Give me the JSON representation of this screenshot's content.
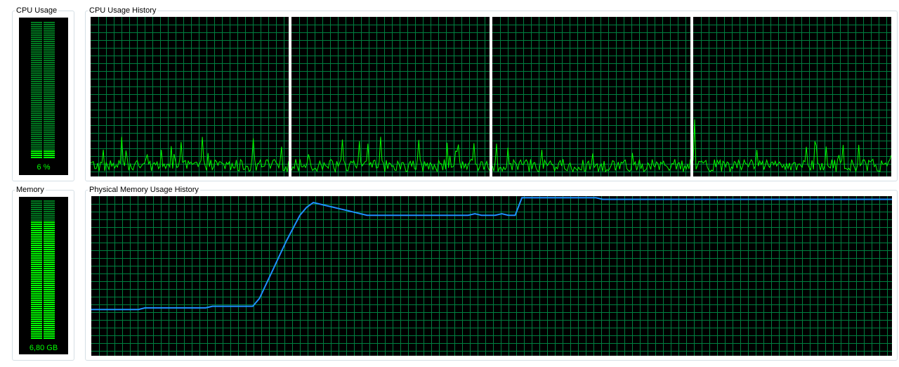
{
  "cpu_usage": {
    "title": "CPU Usage",
    "value_text": "6 %",
    "usage_fraction": 0.06
  },
  "cpu_history": {
    "title": "CPU Usage History",
    "core_count": 4,
    "grid_color": "#008040",
    "line_color": "#00ff00"
  },
  "memory": {
    "title": "Memory",
    "value_text": "6,80 GB",
    "usage_fraction": 0.85
  },
  "memory_history": {
    "title": "Physical Memory Usage History",
    "grid_color": "#008040",
    "line_color": "#1e90ff",
    "series_fraction": [
      0.29,
      0.29,
      0.29,
      0.29,
      0.29,
      0.29,
      0.29,
      0.29,
      0.3,
      0.3,
      0.3,
      0.3,
      0.3,
      0.3,
      0.3,
      0.3,
      0.3,
      0.3,
      0.31,
      0.31,
      0.31,
      0.31,
      0.31,
      0.31,
      0.31,
      0.36,
      0.45,
      0.54,
      0.63,
      0.72,
      0.8,
      0.88,
      0.93,
      0.96,
      0.95,
      0.94,
      0.93,
      0.92,
      0.91,
      0.9,
      0.89,
      0.88,
      0.88,
      0.88,
      0.88,
      0.88,
      0.88,
      0.88,
      0.88,
      0.88,
      0.88,
      0.88,
      0.88,
      0.88,
      0.88,
      0.88,
      0.88,
      0.89,
      0.88,
      0.88,
      0.88,
      0.89,
      0.88,
      0.88,
      0.99,
      0.99,
      0.99,
      0.99,
      0.99,
      0.99,
      0.99,
      0.99,
      0.99,
      0.99,
      0.99,
      0.99,
      0.98,
      0.98,
      0.98,
      0.98,
      0.98,
      0.98,
      0.98,
      0.98,
      0.98,
      0.98,
      0.98,
      0.98,
      0.98,
      0.98,
      0.98,
      0.98,
      0.98,
      0.98,
      0.98,
      0.98,
      0.98,
      0.98,
      0.98,
      0.98,
      0.98,
      0.98,
      0.98,
      0.98,
      0.98,
      0.98,
      0.98,
      0.98,
      0.98,
      0.98,
      0.98,
      0.98,
      0.98,
      0.98,
      0.98,
      0.98,
      0.98,
      0.98,
      0.98,
      0.98
    ]
  }
}
